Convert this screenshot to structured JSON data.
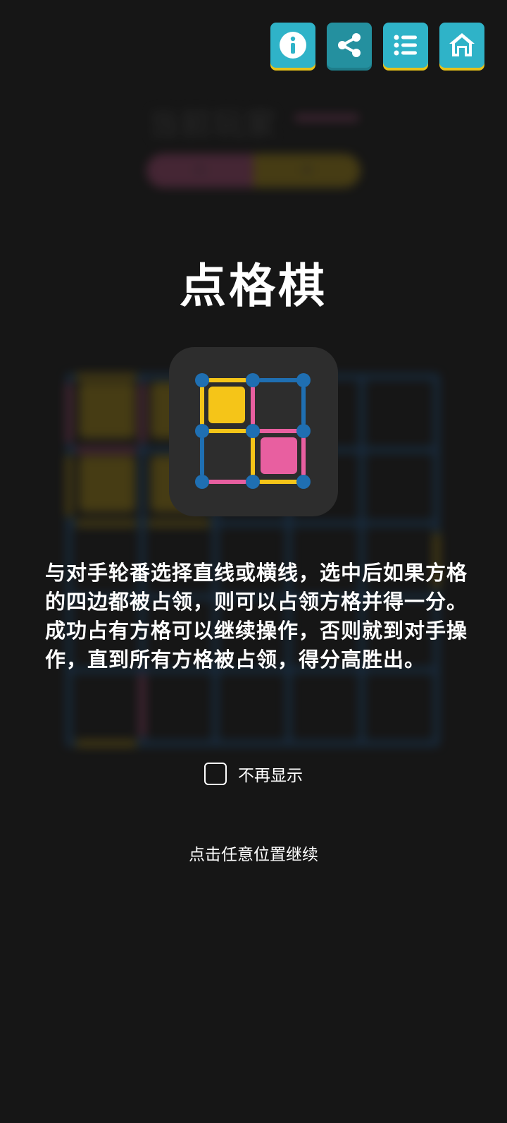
{
  "toolbar": {
    "buttons": [
      {
        "name": "info",
        "icon": "info-icon"
      },
      {
        "name": "share",
        "icon": "share-icon"
      },
      {
        "name": "list",
        "icon": "list-icon"
      },
      {
        "name": "home",
        "icon": "home-icon"
      }
    ]
  },
  "background": {
    "title": "当前玩家",
    "score_left": "0",
    "score_right": "0"
  },
  "dialog": {
    "title": "点格棋",
    "rules": "与对手轮番选择直线或横线，选中后如果方格的四边都被占领，则可以占领方格并得一分。成功占有方格可以继续操作，否则就到对手操作，直到所有方格被占领，得分高胜出。",
    "dont_show_label": "不再显示",
    "dont_show_checked": false,
    "continue_hint": "点击任意位置继续"
  },
  "colors": {
    "background": "#181818",
    "button": "#2fb3c8",
    "button_underline": "#e6c21a",
    "yellow": "#f5c518",
    "pink": "#e85fa0",
    "blue": "#1f6fb2",
    "logo_bg": "#2d2d2d"
  }
}
